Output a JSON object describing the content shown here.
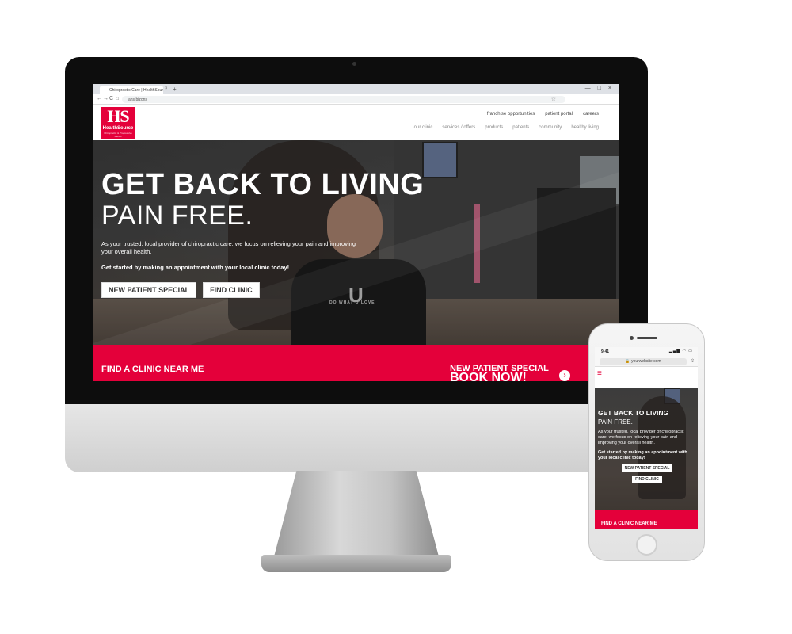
{
  "desktop": {
    "browser": {
      "tab_title": "Chiropractic Care | HealthSource",
      "tab_close": "×",
      "tab_new": "+",
      "window_controls": [
        "—",
        "□",
        "×"
      ],
      "nav_back": "←",
      "nav_forward": "→",
      "nav_reload": "C",
      "nav_home": "⌂",
      "url": "ahs.bizons",
      "star": "☆"
    },
    "logo": {
      "mark": "HS",
      "name": "HealthSource",
      "sub": "Chiropractic & Progressive Rehab"
    },
    "util_nav": [
      "franchise opportunities",
      "patient portal",
      "careers"
    ],
    "main_nav": [
      "our clinic",
      "services / offers",
      "products",
      "patients",
      "community",
      "healthy living"
    ],
    "hero": {
      "title": "GET BACK TO LIVING",
      "subtitle": "PAIN FREE.",
      "description": "As your trusted, local provider of chiropractic care, we focus on relieving your pain and improving your overall health.",
      "cta_text": "Get started by making an appointment with your local clinic today!",
      "buttons": [
        "NEW PATIENT SPECIAL",
        "FIND CLINIC"
      ],
      "shirt_letter": "U",
      "shirt_text": "DO WHAT U LOVE"
    },
    "band": {
      "left": "FIND A CLINIC NEAR ME",
      "right_title": "NEW PATIENT SPECIAL",
      "right_sub": "BOOK NOW!",
      "arrow": "›"
    }
  },
  "mobile": {
    "status": {
      "time": "9:41",
      "icons": "▂▄▆ ◠ ▭"
    },
    "url": "🔒 yourwebsite.com",
    "share": "⇪",
    "menu": "≡",
    "hero": {
      "title": "GET BACK TO LIVING",
      "subtitle": "PAIN FREE.",
      "description": "As your trusted, local provider of chiropractic care, we focus on relieving your pain and improving your overall health.",
      "cta_text": "Get started by making an appointment with your local clinic today!",
      "buttons": [
        "NEW PATIENT SPECIAL",
        "FIND CLINIC"
      ]
    },
    "band": {
      "left": "FIND A CLINIC NEAR ME"
    }
  },
  "colors": {
    "brand_red": "#e4003a",
    "bezel": "#0d0d0d"
  }
}
